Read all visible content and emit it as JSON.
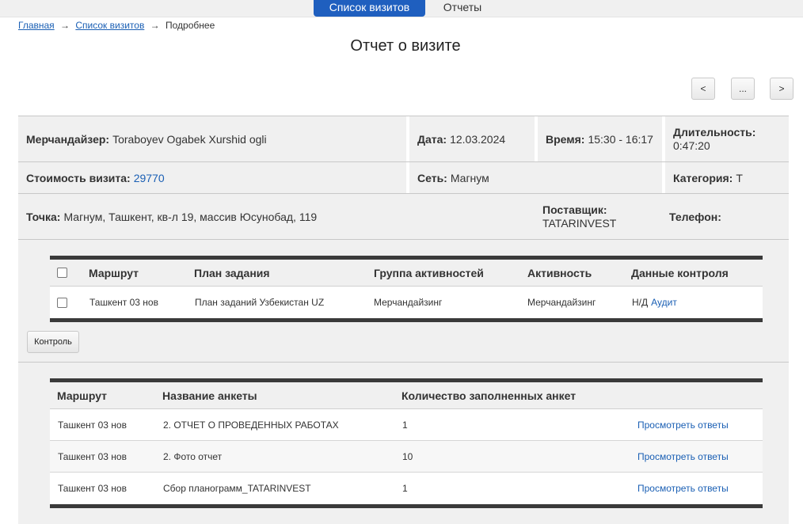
{
  "nav": {
    "tabs": [
      {
        "label": "Список визитов",
        "active": true
      },
      {
        "label": "Отчеты",
        "active": false
      }
    ]
  },
  "breadcrumb": {
    "home": "Главная",
    "visits": "Список визитов",
    "current": "Подробнее",
    "separator": "→"
  },
  "page_title": "Отчет о визите",
  "pager": {
    "prev": "<",
    "more": "...",
    "next": ">"
  },
  "info": {
    "merchandiser_label": "Мерчандайзер:",
    "merchandiser_value": "Toraboyev Ogabek Xurshid ogli",
    "date_label": "Дата:",
    "date_value": "12.03.2024",
    "time_label": "Время:",
    "time_value": "15:30 - 16:17",
    "duration_label": "Длительность:",
    "duration_value": "0:47:20",
    "cost_label": "Стоимость визита:",
    "cost_value": "29770",
    "network_label": "Сеть:",
    "network_value": "Магнум",
    "category_label": "Категория:",
    "category_value": "T",
    "point_label": "Точка:",
    "point_value": "Магнум, Ташкент, кв-л 19, массив Юсунобад, 119",
    "supplier_label": "Поставщик:",
    "supplier_value": "TATARINVEST",
    "phone_label": "Телефон:"
  },
  "tasks_table": {
    "headers": {
      "route": "Маршрут",
      "plan": "План задания",
      "group": "Группа активностей",
      "activity": "Активность",
      "control": "Данные контроля"
    },
    "rows": [
      {
        "route": "Ташкент 03 нов",
        "plan": "План заданий Узбекистан UZ",
        "group": "Мерчандайзинг",
        "activity": "Мерчандайзинг",
        "control_status": "Н/Д",
        "control_link": "Аудит"
      }
    ]
  },
  "control_button": "Контроль",
  "surveys_table": {
    "headers": {
      "route": "Маршрут",
      "name": "Название анкеты",
      "count": "Количество заполненных анкет"
    },
    "rows": [
      {
        "route": "Ташкент 03 нов",
        "name": "2. ОТЧЕТ О ПРОВЕДЕННЫХ РАБОТАХ",
        "count": "1",
        "link": "Просмотреть ответы"
      },
      {
        "route": "Ташкент 03 нов",
        "name": "2. Фото отчет",
        "count": "10",
        "link": "Просмотреть ответы"
      },
      {
        "route": "Ташкент 03 нов",
        "name": "Сбор планограмм_TATARINVEST",
        "count": "1",
        "link": "Просмотреть ответы"
      }
    ]
  },
  "colors": {
    "accent": "#1f5fbf",
    "link": "#1a5fb4",
    "panel": "#f0f0f0",
    "table_border": "#3a3a3a"
  }
}
